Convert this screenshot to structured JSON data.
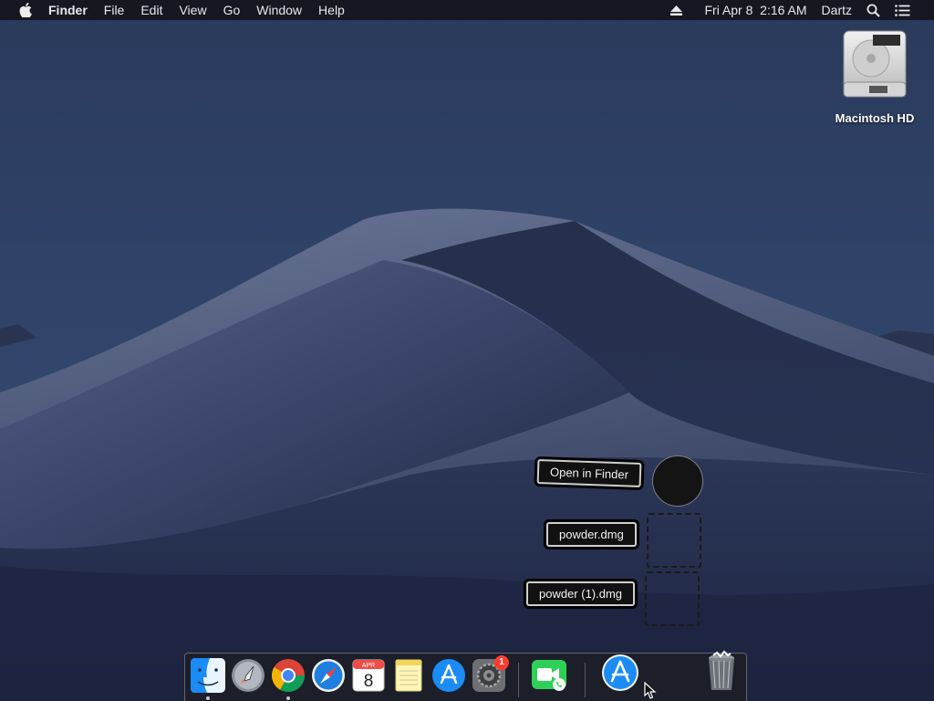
{
  "menubar": {
    "apple_icon": "apple-logo-icon",
    "app_name": "Finder",
    "menus": [
      "File",
      "Edit",
      "View",
      "Go",
      "Window",
      "Help"
    ],
    "status": {
      "eject_icon": "eject-icon",
      "datetime": "Fri Apr 8  2:16 AM",
      "user": "Dartz",
      "search_icon": "spotlight-search-icon",
      "list_icon": "notification-center-icon"
    }
  },
  "desktop": {
    "hd_icon": {
      "label": "Macintosh HD",
      "icon": "hard-drive-icon"
    }
  },
  "widgets": {
    "open_in_finder": "Open in Finder",
    "file1": "powder.dmg",
    "file2": "powder (1).dmg"
  },
  "dock": {
    "apps": [
      {
        "name": "Finder",
        "icon": "finder-icon",
        "running": true
      },
      {
        "name": "Launchpad",
        "icon": "launchpad-icon",
        "running": false
      },
      {
        "name": "Google Chrome",
        "icon": "chrome-icon",
        "running": true
      },
      {
        "name": "Safari",
        "icon": "safari-icon",
        "running": false
      },
      {
        "name": "Calendar",
        "icon": "calendar-icon",
        "running": false,
        "month": "APR",
        "day": "8"
      },
      {
        "name": "Notes",
        "icon": "notes-icon",
        "running": false
      },
      {
        "name": "App Store",
        "icon": "app-store-icon",
        "running": false
      },
      {
        "name": "System Preferences",
        "icon": "system-preferences-icon",
        "running": false,
        "badge": "1"
      },
      {
        "name": "FaceTime",
        "icon": "facetime-icon",
        "running": false
      },
      {
        "name": "App Store Installer",
        "icon": "app-store-installer-icon",
        "running": false
      },
      {
        "name": "Trash",
        "icon": "trash-icon",
        "running": false
      }
    ]
  },
  "colors": {
    "menubar_bg": "#14161c",
    "wallpaper_sky": "#2b3c5e",
    "badge": "#ff3b30",
    "accent_blue": "#1b8cf5"
  }
}
